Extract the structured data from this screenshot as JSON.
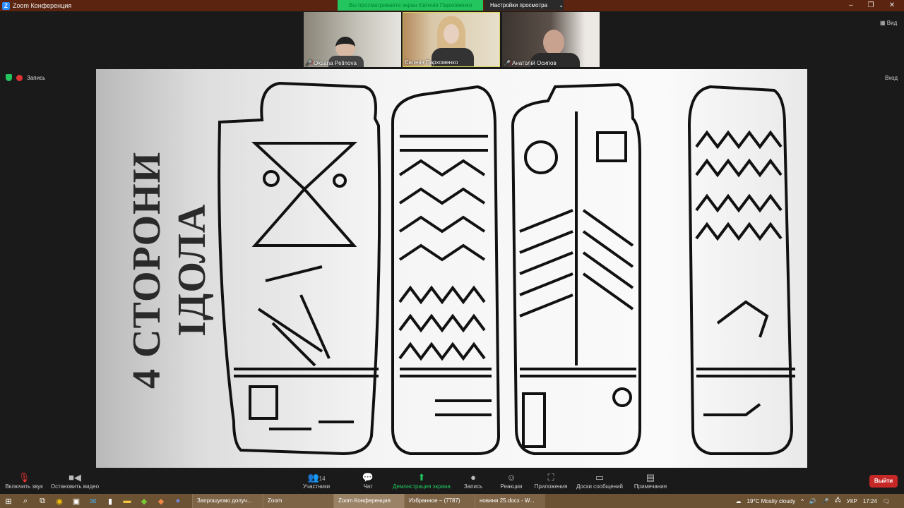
{
  "window": {
    "title": "Zoom Конференция",
    "controls": [
      "–",
      "❐",
      "✕"
    ]
  },
  "share_banner": "Вы просматриваете экран Євгенія Пархоменко",
  "view_options": "Настройки просмотра",
  "view_label": "Вид",
  "exit_fullscreen": "Вход",
  "recording": "Запись",
  "participants": [
    {
      "name": "Oksana Petinova",
      "muted": true
    },
    {
      "name": "Євгенія Пархоменко",
      "muted": false
    },
    {
      "name": "Анатолій Осипов",
      "muted": true
    }
  ],
  "slide": {
    "title": "4 СТОРОНИ ІДОЛА"
  },
  "toolbar": {
    "unmute": "Включить звук",
    "stop_video": "Остановить видео",
    "participants": "Участники",
    "participants_count": "14",
    "chat": "Чат",
    "share": "Демонстрация экрана",
    "record": "Запись",
    "reactions": "Реакции",
    "apps": "Приложения",
    "whiteboards": "Доски сообщений",
    "notes": "Примечания",
    "leave": "Выйти"
  },
  "taskbar": {
    "tasks": [
      "Запрошуємо долуч...",
      "Zoom",
      "Zoom Конференция",
      "Избранное – (7787)",
      "новини 25.docx - W..."
    ],
    "weather": "19°C  Mostly cloudy",
    "lang": "УКР",
    "time": "17:24"
  },
  "colors": {
    "title_bar": "#5b2410",
    "share_green": "#22c55e",
    "leave_red": "#c62828",
    "taskbar": "#6b5233"
  }
}
